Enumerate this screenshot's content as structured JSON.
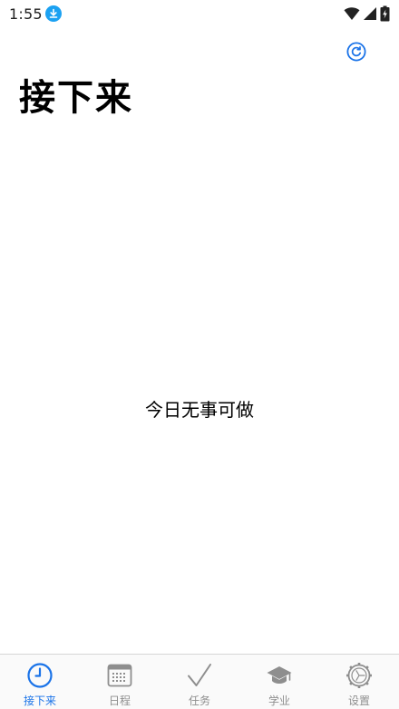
{
  "status": {
    "time": "1:55",
    "icons": [
      "download-icon",
      "wifi-icon",
      "cellular-signal-icon",
      "battery-charging-icon"
    ]
  },
  "header": {
    "title": "接下来",
    "refresh_icon": "refresh-icon"
  },
  "main": {
    "empty_message": "今日无事可做"
  },
  "tabbar": {
    "active_index": 0,
    "items": [
      {
        "label": "接下来",
        "icon": "clock-icon"
      },
      {
        "label": "日程",
        "icon": "calendar-icon"
      },
      {
        "label": "任务",
        "icon": "checkmark-icon"
      },
      {
        "label": "学业",
        "icon": "graduation-cap-icon"
      },
      {
        "label": "设置",
        "icon": "gear-icon"
      }
    ]
  },
  "colors": {
    "accent": "#1a73e8",
    "inactive": "#8e8e8e",
    "download_badge": "#1ba1f2"
  }
}
